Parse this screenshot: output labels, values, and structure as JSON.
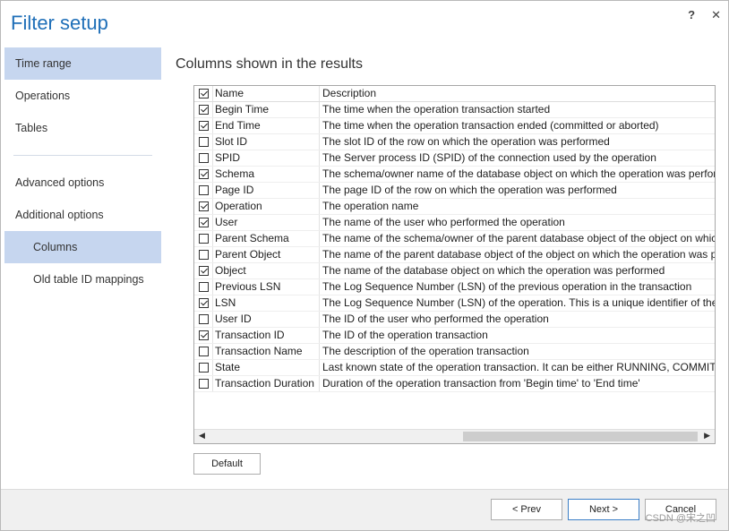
{
  "window": {
    "title": "Filter setup",
    "help_icon": "?",
    "close_icon": "✕"
  },
  "sidebar": {
    "items": [
      {
        "label": "Time range",
        "active": true
      },
      {
        "label": "Operations"
      },
      {
        "label": "Tables"
      },
      {
        "label": "Advanced options"
      },
      {
        "label": "Additional options"
      },
      {
        "label": "Columns",
        "active": true
      },
      {
        "label": "Old table ID mappings"
      }
    ]
  },
  "main": {
    "title": "Columns shown in the results",
    "columns": {
      "name": "Name",
      "description": "Description"
    },
    "rows": [
      {
        "name": "Begin Time",
        "description": "The time when the operation transaction started",
        "checked": true
      },
      {
        "name": "End Time",
        "description": "The time when the operation transaction ended (committed or aborted)",
        "checked": true
      },
      {
        "name": "Slot ID",
        "description": "The slot ID of the row on which the operation was performed",
        "checked": false
      },
      {
        "name": "SPID",
        "description": "The Server process ID (SPID) of the connection used by the operation",
        "checked": false
      },
      {
        "name": "Schema",
        "description": "The schema/owner name of the database object on which the operation was performed",
        "checked": true
      },
      {
        "name": "Page ID",
        "description": "The page ID of the row on which the operation was performed",
        "checked": false
      },
      {
        "name": "Operation",
        "description": "The operation name",
        "checked": true
      },
      {
        "name": "User",
        "description": "The name of the user who performed the operation",
        "checked": true
      },
      {
        "name": "Parent Schema",
        "description": "The name of the schema/owner of the parent database object of the object on which the o",
        "checked": false
      },
      {
        "name": "Parent Object",
        "description": "The name of the parent database object of the object on which the operation was performe",
        "checked": false
      },
      {
        "name": "Object",
        "description": "The name of the database object on which the operation was performed",
        "checked": true
      },
      {
        "name": "Previous LSN",
        "description": "The Log Sequence Number (LSN) of the previous operation in the transaction",
        "checked": false
      },
      {
        "name": "LSN",
        "description": "The Log Sequence Number (LSN) of the operation. This is a unique identifier of the operat",
        "checked": true
      },
      {
        "name": "User ID",
        "description": "The ID of the user who performed the operation",
        "checked": false
      },
      {
        "name": "Transaction ID",
        "description": "The ID of the operation transaction",
        "checked": true
      },
      {
        "name": "Transaction Name",
        "description": "The description of the operation transaction",
        "checked": false
      },
      {
        "name": "State",
        "description": "Last known state of the operation transaction. It can be either RUNNING, COMMITTED, A",
        "checked": false
      },
      {
        "name": "Transaction Duration",
        "description": "Duration of the operation transaction from 'Begin time' to 'End time'",
        "checked": false
      }
    ],
    "default_button": "Default"
  },
  "footer": {
    "prev_button": "< Prev",
    "next_button": "Next >",
    "cancel_button": "Cancel",
    "watermark": "CSDN @宋之凹"
  }
}
